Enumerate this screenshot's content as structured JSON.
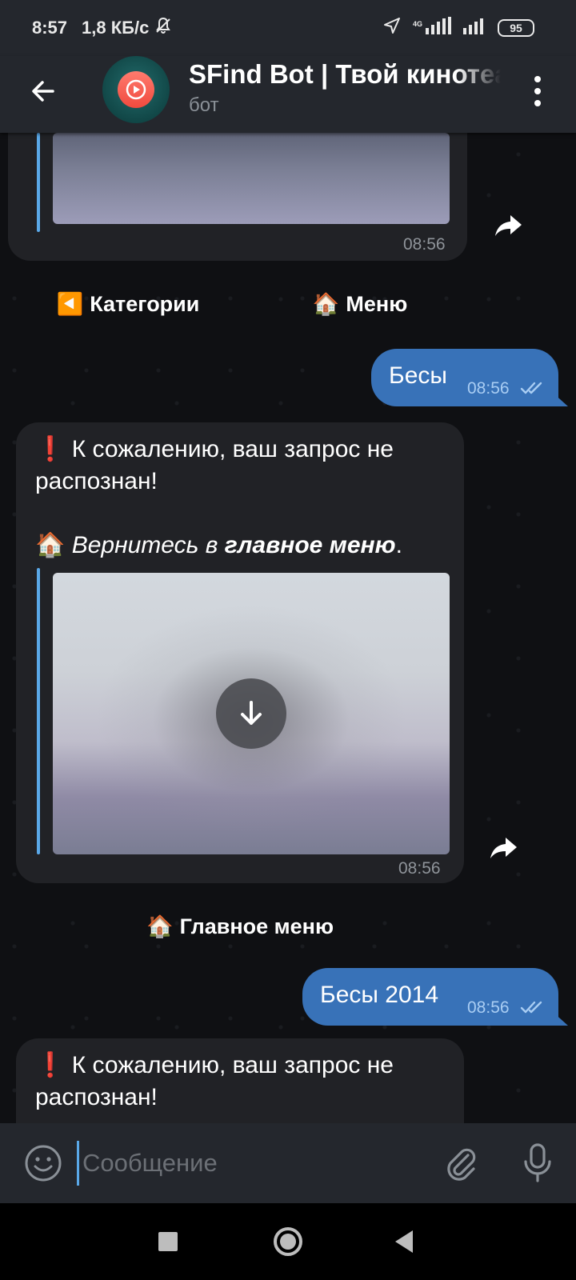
{
  "status_bar": {
    "time": "8:57",
    "speed": "1,8 КБ/с",
    "network_label": "4G",
    "battery": "95"
  },
  "header": {
    "title": "SFind Bot | Твой кинотеатр",
    "subtitle": "бот"
  },
  "messages": {
    "top_partial": {
      "time": "08:56"
    },
    "kb1": {
      "categories_label": "Категории",
      "categories_emoji": "◀️",
      "menu_label": "Меню",
      "menu_emoji": "🏠"
    },
    "out1": {
      "text": "Бесы",
      "time": "08:56"
    },
    "bot_reply": {
      "warn_emoji": "❗",
      "line1": "К сожалению, ваш запрос не распознан!",
      "home_emoji": "🏠",
      "return_italic": "Вернитесь в ",
      "return_bold": "главное меню",
      "return_end": ".",
      "time": "08:56"
    },
    "kb2": {
      "main_menu_label": "Главное меню",
      "main_menu_emoji": "🏠"
    },
    "out2": {
      "text": "Бесы 2014",
      "time": "08:56"
    },
    "bot_reply_partial": {
      "warn_emoji": "❗",
      "line1": "К сожалению, ваш запрос не",
      "line2": "распознан!"
    }
  },
  "input": {
    "placeholder": "Сообщение",
    "value": ""
  },
  "icons": {
    "back": "arrow-left-icon",
    "menu": "more-vertical-icon",
    "forward": "share-forward-icon",
    "download": "download-arrow-icon",
    "emoji": "smiley-icon",
    "attach": "paperclip-icon",
    "mic": "microphone-icon"
  },
  "colors": {
    "header_bg": "#24272d",
    "bubble_in": "#212226",
    "bubble_out": "#3872b8",
    "accent": "#5aa8e8"
  }
}
